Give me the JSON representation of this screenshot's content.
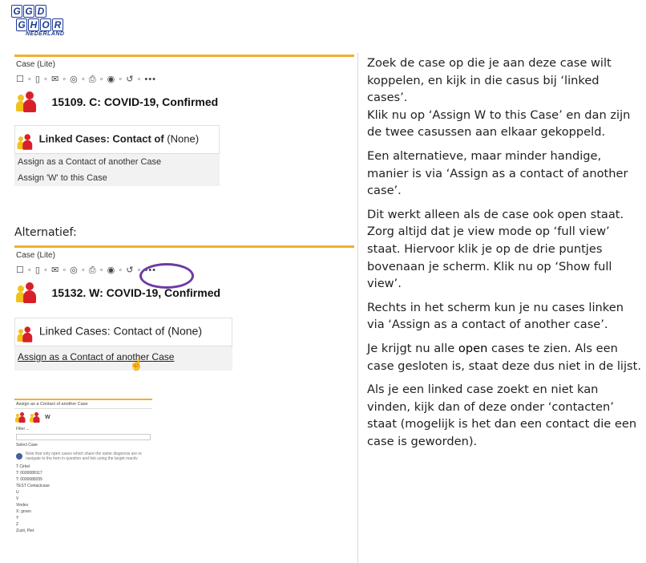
{
  "logo": {
    "row1": [
      "G",
      "G",
      "D"
    ],
    "row2": [
      "G",
      "H",
      "O",
      "R"
    ],
    "sub": "NEDERLAND"
  },
  "panel1": {
    "header": "Case (Lite)",
    "toolbar": "☐ ◦ ▯ ◦ ✉ ◦ ◎ ◦ ⎙ ◦ ◉ ◦ ↺ ◦ •••",
    "case_title": "15109. C: COVID-19, Confirmed",
    "linked_label": "Linked Cases: Contact of",
    "linked_value": "(None)",
    "items": [
      "Assign as a Contact of another Case",
      "Assign 'W' to this Case"
    ]
  },
  "alt_label": "Alternatief:",
  "panel2": {
    "header": "Case (Lite)",
    "toolbar": "☐ ◦ ▯ ◦ ✉ ◦ ◎ ◦ ⎙ ◦ ◉ ◦ ↺ ◦ •••",
    "case_title": "15132. W: COVID-19, Confirmed",
    "linked_label": "Linked Cases: Contact of",
    "linked_value": "(None)",
    "item": "Assign as a Contact of another Case"
  },
  "dialog": {
    "title": "Assign as a Contact of another Case",
    "avatar_label": "W",
    "filter": "Filter ...",
    "select": "Select Case",
    "note": "Note that only open cases which share the same diagnosis are re navigate to the item in question and link using the target reactiv",
    "list": [
      "T Cirkel",
      "T: 0000088117",
      "T: 0000088255",
      "TEST Contactcase",
      "U",
      "V",
      "Vindex",
      "X: groen",
      "Y",
      "Z",
      "Zuzit, Piet"
    ]
  },
  "right_text": {
    "p1": "Zoek de case op die je aan deze case wilt koppelen, en kijk in die casus bij ‘linked cases’.",
    "p2": "Klik nu op ‘Assign W to this Case’ en dan zijn de twee casussen aan elkaar gekoppeld.",
    "p3": "Een alternatieve, maar minder handige, manier is via ‘Assign as a contact of another case’.",
    "p4": "Dit werkt alleen als de case ook open staat. Zorg altijd dat je view mode op ‘full view’ staat. Hiervoor klik je op de drie puntjes bovenaan je scherm. Klik nu op ‘Show full view’.",
    "p5": "Rechts in het scherm kun je nu cases linken via ‘Assign as a contact of another case’.",
    "p6_before": "Je krijgt nu alle ",
    "p6_bold": "open",
    "p6_after": " cases te zien. Als een case gesloten is, staat deze dus niet in de lijst.",
    "p7": "Als je een linked case zoekt en niet kan vinden, kijk dan of deze onder ‘contacten’ staat (mogelijk is het dan een contact die een case is geworden)."
  }
}
